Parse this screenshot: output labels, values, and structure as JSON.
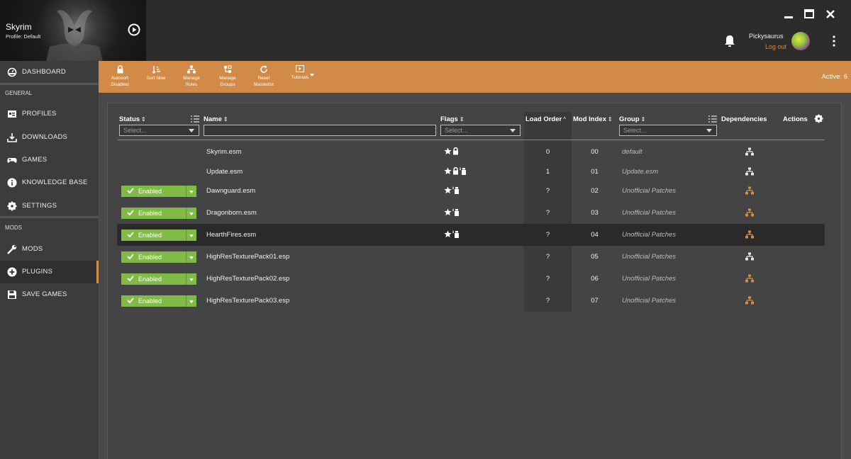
{
  "game": {
    "title": "Skyrim",
    "profile": "Profile: Default"
  },
  "user": {
    "name": "Pickysaurus",
    "logout_label": "Log out"
  },
  "sidebar": {
    "dashboard": "DASHBOARD",
    "general_title": "GENERAL",
    "general_items": [
      "PROFILES",
      "DOWNLOADS",
      "GAMES",
      "KNOWLEDGE BASE",
      "SETTINGS"
    ],
    "mods_title": "MODS",
    "mods_items": [
      "MODS",
      "PLUGINS",
      "SAVE GAMES"
    ],
    "active_item": "PLUGINS"
  },
  "toolbar": {
    "autosort_l1": "Autosort",
    "autosort_l2": "Disabled",
    "sortnow": "Sort Now",
    "rules_l1": "Manage",
    "rules_l2": "Rules",
    "groups_l1": "Manage",
    "groups_l2": "Groups",
    "reset_l1": "Reset",
    "reset_l2": "Masterlist",
    "tutorials": "Tutorials",
    "active_count": "Active: 6"
  },
  "columns": {
    "status": "Status",
    "name": "Name",
    "flags": "Flags",
    "load_order": "Load Order",
    "mod_index": "Mod Index",
    "group": "Group",
    "dependencies": "Dependencies",
    "actions": "Actions",
    "select_placeholder": "Select..."
  },
  "accent_color": "#d18a47",
  "enabled_color": "#7fbb45",
  "plugins": [
    {
      "name": "Skyrim.esm",
      "status": "",
      "flags": [
        "star-icon",
        "lock-icon"
      ],
      "load_order": "0",
      "mod_index": "00",
      "group": "default",
      "dep_color": "#e8e8e8"
    },
    {
      "name": "Update.esm",
      "status": "",
      "flags": [
        "star-icon",
        "lock-icon",
        "clean-icon"
      ],
      "load_order": "1",
      "mod_index": "01",
      "group": "Update.esm",
      "dep_color": "#e8e8e8"
    },
    {
      "name": "Dawnguard.esm",
      "status": "Enabled",
      "flags": [
        "star-icon",
        "clean-icon"
      ],
      "load_order": "?",
      "mod_index": "02",
      "group": "Unofficial Patches",
      "dep_color": "#d58e45"
    },
    {
      "name": "Dragonborn.esm",
      "status": "Enabled",
      "flags": [
        "star-icon",
        "clean-icon"
      ],
      "load_order": "?",
      "mod_index": "03",
      "group": "Unofficial Patches",
      "dep_color": "#d58e45"
    },
    {
      "name": "HearthFires.esm",
      "status": "Enabled",
      "flags": [
        "star-icon",
        "clean-icon"
      ],
      "load_order": "?",
      "mod_index": "04",
      "group": "Unofficial Patches",
      "dep_color": "#d58e45",
      "selected": true
    },
    {
      "name": "HighResTexturePack01.esp",
      "status": "Enabled",
      "flags": [],
      "load_order": "?",
      "mod_index": "05",
      "group": "Unofficial Patches",
      "dep_color": "#e8e8e8"
    },
    {
      "name": "HighResTexturePack02.esp",
      "status": "Enabled",
      "flags": [],
      "load_order": "?",
      "mod_index": "06",
      "group": "Unofficial Patches",
      "dep_color": "#d58e45"
    },
    {
      "name": "HighResTexturePack03.esp",
      "status": "Enabled",
      "flags": [],
      "load_order": "?",
      "mod_index": "07",
      "group": "Unofficial Patches",
      "dep_color": "#d58e45"
    }
  ]
}
